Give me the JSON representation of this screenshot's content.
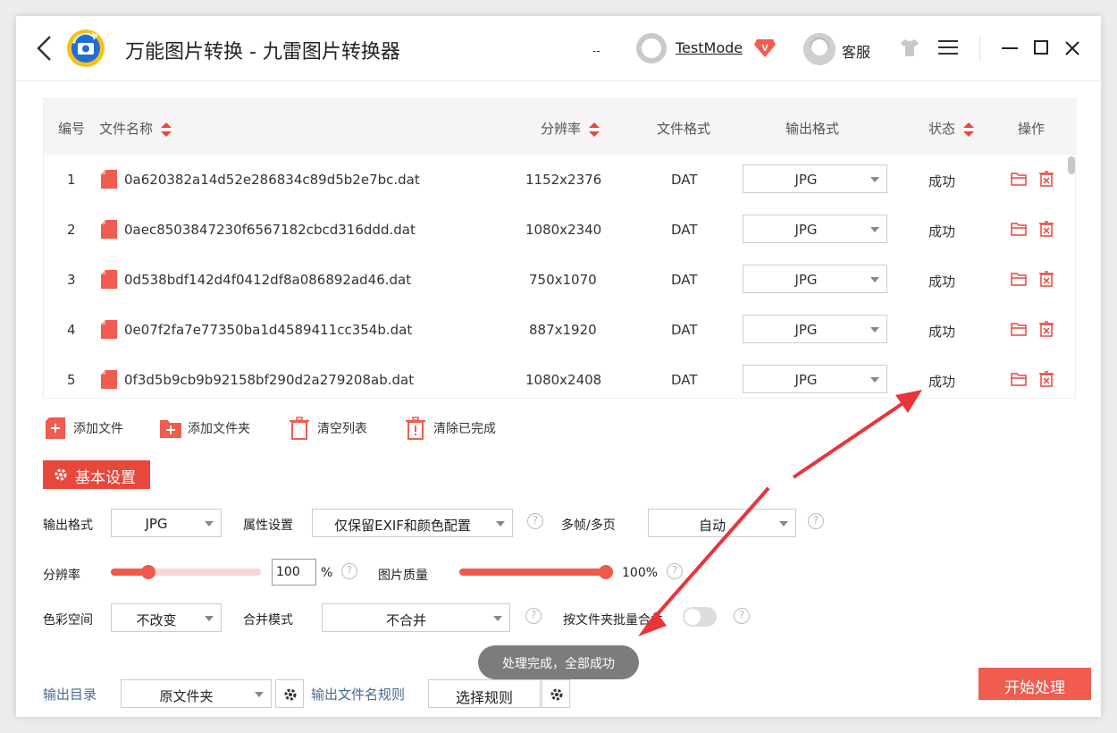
{
  "titlebar": {
    "title": "万能图片转换 - 九雷图片转换器",
    "dashes": "--",
    "username": "TestMode",
    "vip_badge": "V",
    "customer_service": "客服"
  },
  "table": {
    "headers": {
      "index": "编号",
      "filename": "文件名称",
      "resolution": "分辨率",
      "format": "文件格式",
      "output_format": "输出格式",
      "status": "状态",
      "actions": "操作"
    },
    "rows": [
      {
        "index": "1",
        "filename": "0a620382a14d52e286834c89d5b2e7bc.dat",
        "resolution": "1152x2376",
        "format": "DAT",
        "output": "JPG",
        "status": "成功"
      },
      {
        "index": "2",
        "filename": "0aec8503847230f6567182cbcd316ddd.dat",
        "resolution": "1080x2340",
        "format": "DAT",
        "output": "JPG",
        "status": "成功"
      },
      {
        "index": "3",
        "filename": "0d538bdf142d4f0412df8a086892ad46.dat",
        "resolution": "750x1070",
        "format": "DAT",
        "output": "JPG",
        "status": "成功"
      },
      {
        "index": "4",
        "filename": "0e07f2fa7e77350ba1d4589411cc354b.dat",
        "resolution": "887x1920",
        "format": "DAT",
        "output": "JPG",
        "status": "成功"
      },
      {
        "index": "5",
        "filename": "0f3d5b9cb9b92158bf290d2a279208ab.dat",
        "resolution": "1080x2408",
        "format": "DAT",
        "output": "JPG",
        "status": "成功"
      }
    ]
  },
  "actions": {
    "add_file": "添加文件",
    "add_folder": "添加文件夹",
    "clear_list": "清空列表",
    "clear_done": "清除已完成"
  },
  "settings": {
    "section_title": "基本设置",
    "output_format_label": "输出格式",
    "output_format_value": "JPG",
    "attr_label": "属性设置",
    "attr_value": "仅保留EXIF和颜色配置",
    "multiframe_label": "多帧/多页",
    "multiframe_value": "自动",
    "resolution_label": "分辨率",
    "resolution_value": "100",
    "resolution_unit": "%",
    "resolution_fraction": 0.25,
    "quality_label": "图片质量",
    "quality_value": "100%",
    "quality_fraction": 1.0,
    "colorspace_label": "色彩空间",
    "colorspace_value": "不改变",
    "merge_label": "合并模式",
    "merge_value": "不合并",
    "folder_merge_label": "按文件夹批量合并",
    "folder_merge_on": false,
    "help": "?"
  },
  "footer": {
    "output_dir_label": "输出目录",
    "output_dir_value": "原文件夹",
    "filename_rule_label": "输出文件名规则",
    "rule_button": "选择规则",
    "start_button": "开始处理"
  },
  "toast": "处理完成，全部成功",
  "colors": {
    "accent": "#e8473b",
    "start_button": "#f05c4f",
    "link": "#4a6b8f"
  }
}
